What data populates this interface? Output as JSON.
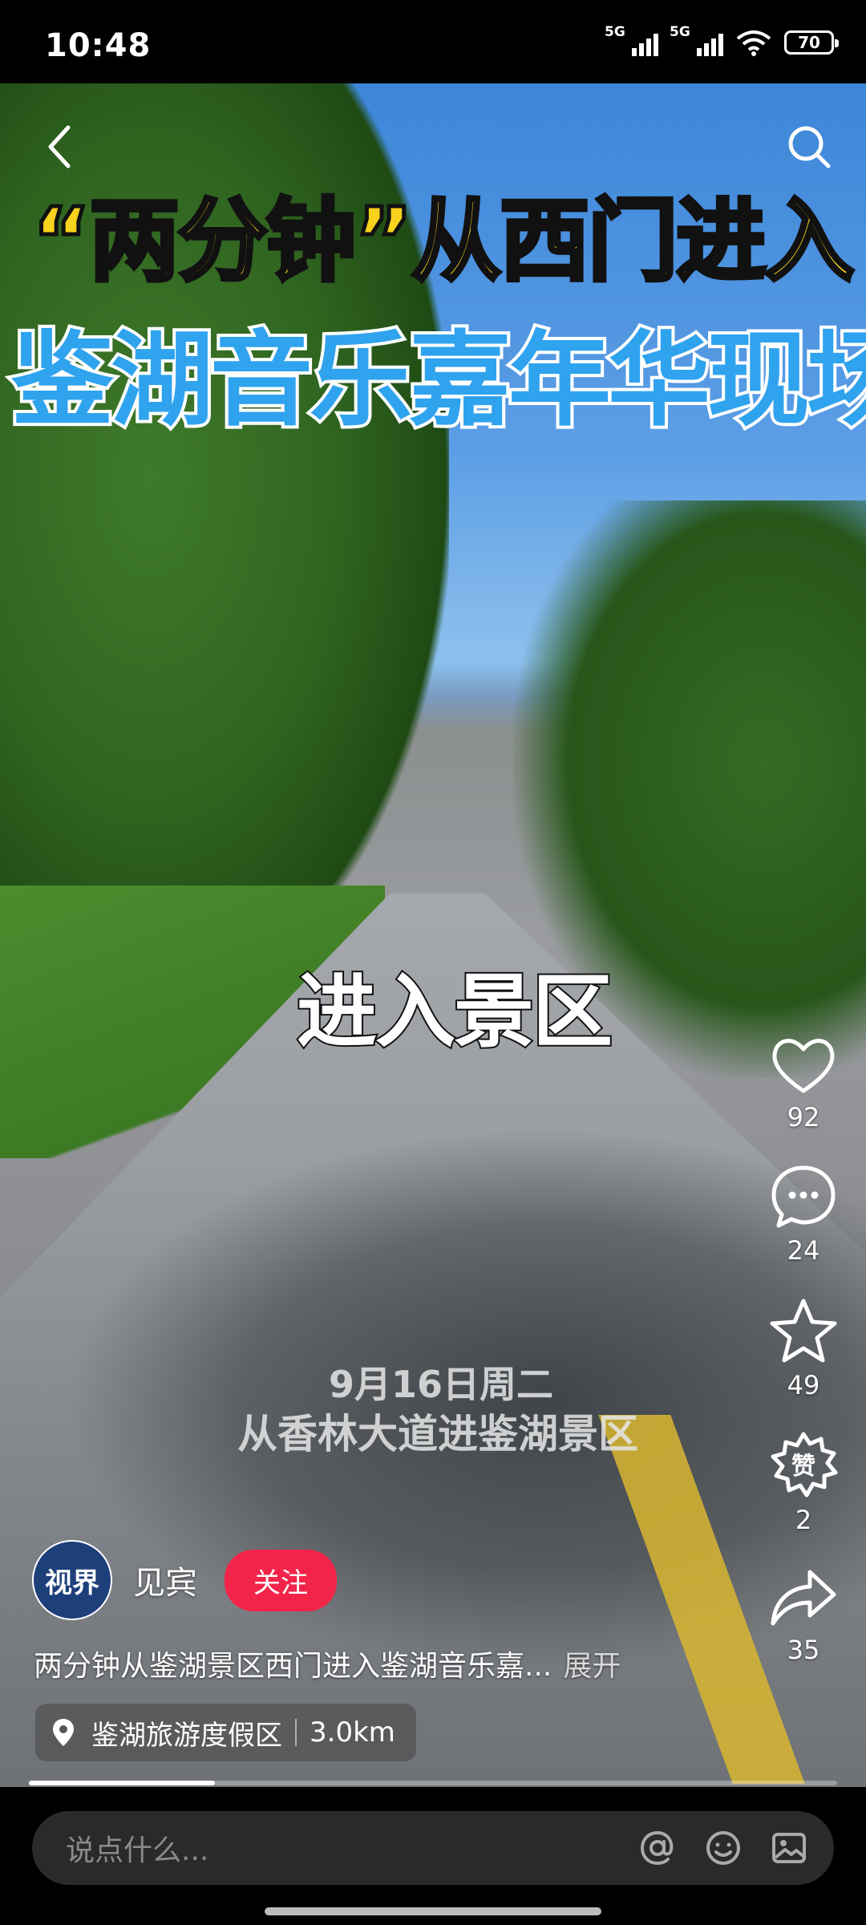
{
  "status_bar": {
    "time": "10:48",
    "net1": "5G",
    "net2": "5G",
    "battery": "70"
  },
  "nav": {
    "back_icon": "chevron-left-icon",
    "search_icon": "search-icon"
  },
  "overlay": {
    "title_line1": "“两分钟”从西门进入",
    "title_line2": "鉴湖音乐嘉年华现场",
    "mid_text": "进入景区",
    "date_text": "9月16日周二",
    "sub_text": "从香林大道进鉴湖景区"
  },
  "actions": [
    {
      "icon": "heart-icon",
      "count": "92"
    },
    {
      "icon": "comment-icon",
      "count": "24"
    },
    {
      "icon": "star-icon",
      "count": "49"
    },
    {
      "icon": "hot-burst-icon",
      "count": "2"
    },
    {
      "icon": "share-icon",
      "count": "35"
    }
  ],
  "author": {
    "avatar_text": "视界",
    "name": "见宾",
    "follow_label": "关注"
  },
  "caption": {
    "text": "两分钟从鉴湖景区西门进入鉴湖音乐嘉...",
    "more": "展开"
  },
  "location": {
    "name": "鉴湖旅游度假区",
    "distance": "3.0km"
  },
  "progress": {
    "fraction": 0.23
  },
  "comment": {
    "placeholder": "说点什么..."
  },
  "colors": {
    "follow_bg": "#f3244a",
    "title_yellow": "#f8d21c",
    "title_blue": "#2fa3ee"
  }
}
